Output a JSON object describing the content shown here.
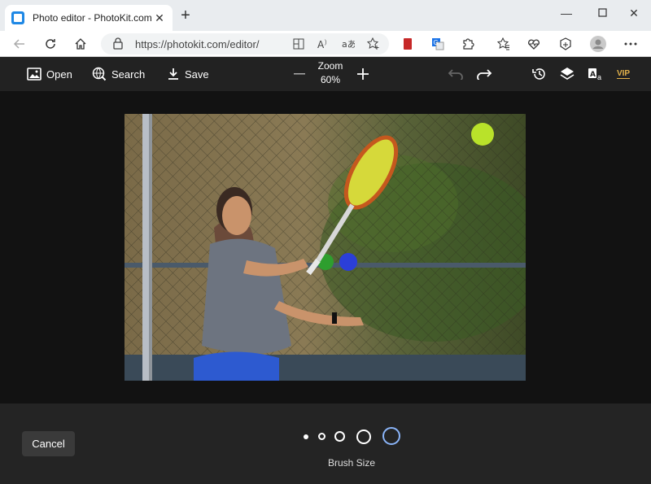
{
  "browser": {
    "tab_title": "Photo editor - PhotoKit.com",
    "url": "https://photokit.com/editor/",
    "icons": [
      "back-icon",
      "refresh-icon",
      "home-icon",
      "lock-icon",
      "split-screen-icon",
      "read-aloud-icon",
      "translate-icon",
      "favorite-add-icon",
      "extension-icon",
      "favorites-icon",
      "health-icon",
      "collections-icon",
      "profile-icon",
      "more-icon"
    ]
  },
  "toolbar": {
    "open_label": "Open",
    "search_label": "Search",
    "save_label": "Save",
    "zoom_label": "Zoom",
    "zoom_value": "60%",
    "vip_label": "VIP",
    "vip_color": "#e0b04a"
  },
  "bottom": {
    "cancel_label": "Cancel",
    "brush_label": "Brush Size",
    "brush_sizes": 5,
    "selected_brush_index": 4,
    "selected_color": "#8ab4f8"
  }
}
